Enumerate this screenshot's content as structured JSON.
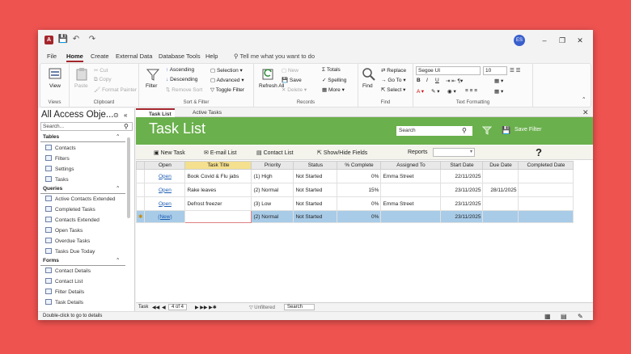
{
  "menubar": {
    "items": [
      "File",
      "Home",
      "Create",
      "External Data",
      "Database Tools",
      "Help"
    ],
    "tell_me": "Tell me what you want to do"
  },
  "user_initials": "ES",
  "ribbon": {
    "views": {
      "label": "Views",
      "view": "View"
    },
    "clipboard": {
      "label": "Clipboard",
      "paste": "Paste",
      "cut": "Cut",
      "copy": "Copy",
      "format_painter": "Format Painter"
    },
    "sort_filter": {
      "label": "Sort & Filter",
      "filter": "Filter",
      "ascending": "Ascending",
      "descending": "Descending",
      "remove_sort": "Remove Sort",
      "selection": "Selection",
      "advanced": "Advanced",
      "toggle_filter": "Toggle Filter"
    },
    "records": {
      "label": "Records",
      "refresh_all": "Refresh All",
      "new": "New",
      "save": "Save",
      "delete": "Delete",
      "totals": "Totals",
      "spelling": "Spelling",
      "more": "More"
    },
    "find": {
      "label": "Find",
      "find": "Find",
      "replace": "Replace",
      "goto": "Go To",
      "select": "Select"
    },
    "text_formatting": {
      "label": "Text Formatting",
      "font": "Segoe UI",
      "size": "10"
    }
  },
  "nav_pane": {
    "title": "All Access Obje...",
    "search_placeholder": "Search...",
    "sections": [
      {
        "name": "Tables",
        "items": [
          "Contacts",
          "Filters",
          "Settings",
          "Tasks"
        ]
      },
      {
        "name": "Queries",
        "items": [
          "Active Contacts Extended",
          "Completed Tasks",
          "Contacts Extended",
          "Open Tasks",
          "Overdue Tasks",
          "Tasks Due Today"
        ]
      },
      {
        "name": "Forms",
        "items": [
          "Contact Details",
          "Contact List",
          "Filter Details",
          "Task Details"
        ]
      }
    ]
  },
  "doc_tabs": [
    "Task List",
    "Active Tasks"
  ],
  "form": {
    "title": "Task List",
    "search_placeholder": "Search",
    "save_filter": "Save Filter",
    "toolbar": {
      "new_task": "New Task",
      "email_list": "E-mail List",
      "contact_list": "Contact List",
      "show_hide": "Show/Hide Fields",
      "reports": "Reports",
      "help": "?"
    },
    "columns": [
      "Open",
      "Task Title",
      "Priority",
      "Status",
      "% Complete",
      "Assigned To",
      "Start Date",
      "Due Date",
      "Completed Date"
    ],
    "rows": [
      [
        "Open",
        "Book Covid & Flu jabs",
        "(1) High",
        "Not Started",
        "0%",
        "Emma Street",
        "22/11/2025",
        "",
        ""
      ],
      [
        "Open",
        "Rake leaves",
        "(2) Normal",
        "Not Started",
        "15%",
        "",
        "23/11/2025",
        "28/11/2025",
        ""
      ],
      [
        "Open",
        "Defrost freezer",
        "(3) Low",
        "Not Started",
        "0%",
        "Emma Street",
        "23/11/2025",
        "",
        ""
      ]
    ],
    "new_row": [
      "(New)",
      "",
      "(2) Normal",
      "Not Started",
      "0%",
      "",
      "23/11/2025",
      "",
      ""
    ]
  },
  "record_nav": {
    "label": "Task",
    "position": "4 of 4",
    "filter_state": "Unfiltered",
    "search": "Search"
  },
  "status_text": "Double-click to go to details",
  "colors": {
    "accent": "#a4262c",
    "header_green": "#6ab04c",
    "selection_blue": "#a8cbe8",
    "background": "#ef5350"
  }
}
